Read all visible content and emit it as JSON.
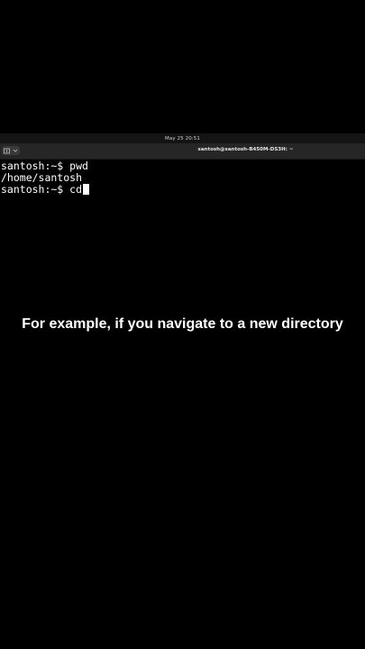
{
  "topbar": {
    "clock": "May 25  20:51"
  },
  "window": {
    "title": "santosh@santosh-B450M-DS3H: ~",
    "tab_icon": "new-tab-icon",
    "menu_icon": "chevron-down-icon"
  },
  "terminal": {
    "lines": [
      {
        "prompt": "santosh:~$ ",
        "command": "pwd"
      },
      {
        "output": "/home/santosh"
      },
      {
        "prompt": "santosh:~$ ",
        "command": "cd"
      }
    ]
  },
  "caption": {
    "text": "For example, if you navigate to a new directory"
  },
  "colors": {
    "background": "#000000",
    "titlebar": "#262626",
    "text": "#ffffff"
  }
}
